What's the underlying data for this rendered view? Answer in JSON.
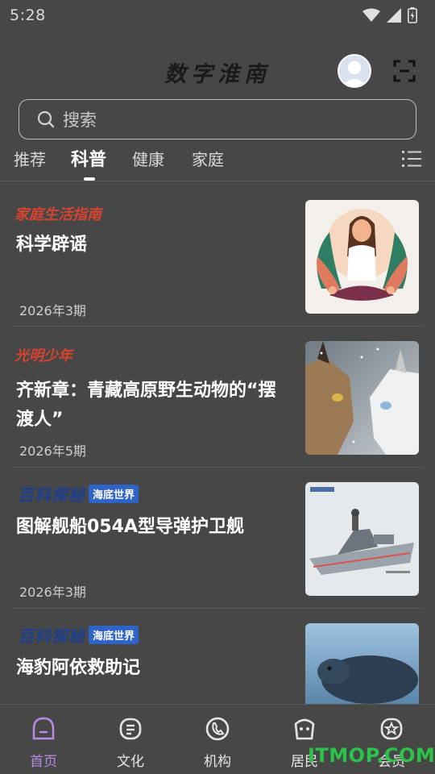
{
  "status_bar": {
    "time": "5:28"
  },
  "header": {
    "app_title": "数字淮南"
  },
  "search": {
    "placeholder": "搜索"
  },
  "tabs": [
    {
      "label": "推荐",
      "active": false
    },
    {
      "label": "科普",
      "active": true
    },
    {
      "label": "健康",
      "active": false
    },
    {
      "label": "家庭",
      "active": false
    }
  ],
  "feed": [
    {
      "source": "家庭生活指南",
      "title": "科学辟谣",
      "date": "2026年3期"
    },
    {
      "source": "光明少年",
      "title": "齐新章：青藏高原野生动物的“摆渡人”",
      "date": "2026年5期"
    },
    {
      "source_logo": {
        "main": "百科探秘",
        "sub": "海底世界"
      },
      "title": "图解舰船054A型导弹护卫舰",
      "date": "2026年3期"
    },
    {
      "source_logo": {
        "main": "百科探秘",
        "sub": "海底世界"
      },
      "title": "海豹阿依救助记",
      "date": ""
    }
  ],
  "bottom_nav": [
    {
      "label": "首页",
      "icon": "home-icon",
      "active": true
    },
    {
      "label": "文化",
      "icon": "culture-icon",
      "active": false
    },
    {
      "label": "机构",
      "icon": "institution-icon",
      "active": false
    },
    {
      "label": "居民",
      "icon": "resident-icon",
      "active": false
    },
    {
      "label": "会员",
      "icon": "member-icon",
      "active": false
    }
  ],
  "watermark": "ITMOP.COM",
  "colors": {
    "background": "#474747",
    "accent_purple": "#b58ce0",
    "source_red": "#d6442f"
  }
}
